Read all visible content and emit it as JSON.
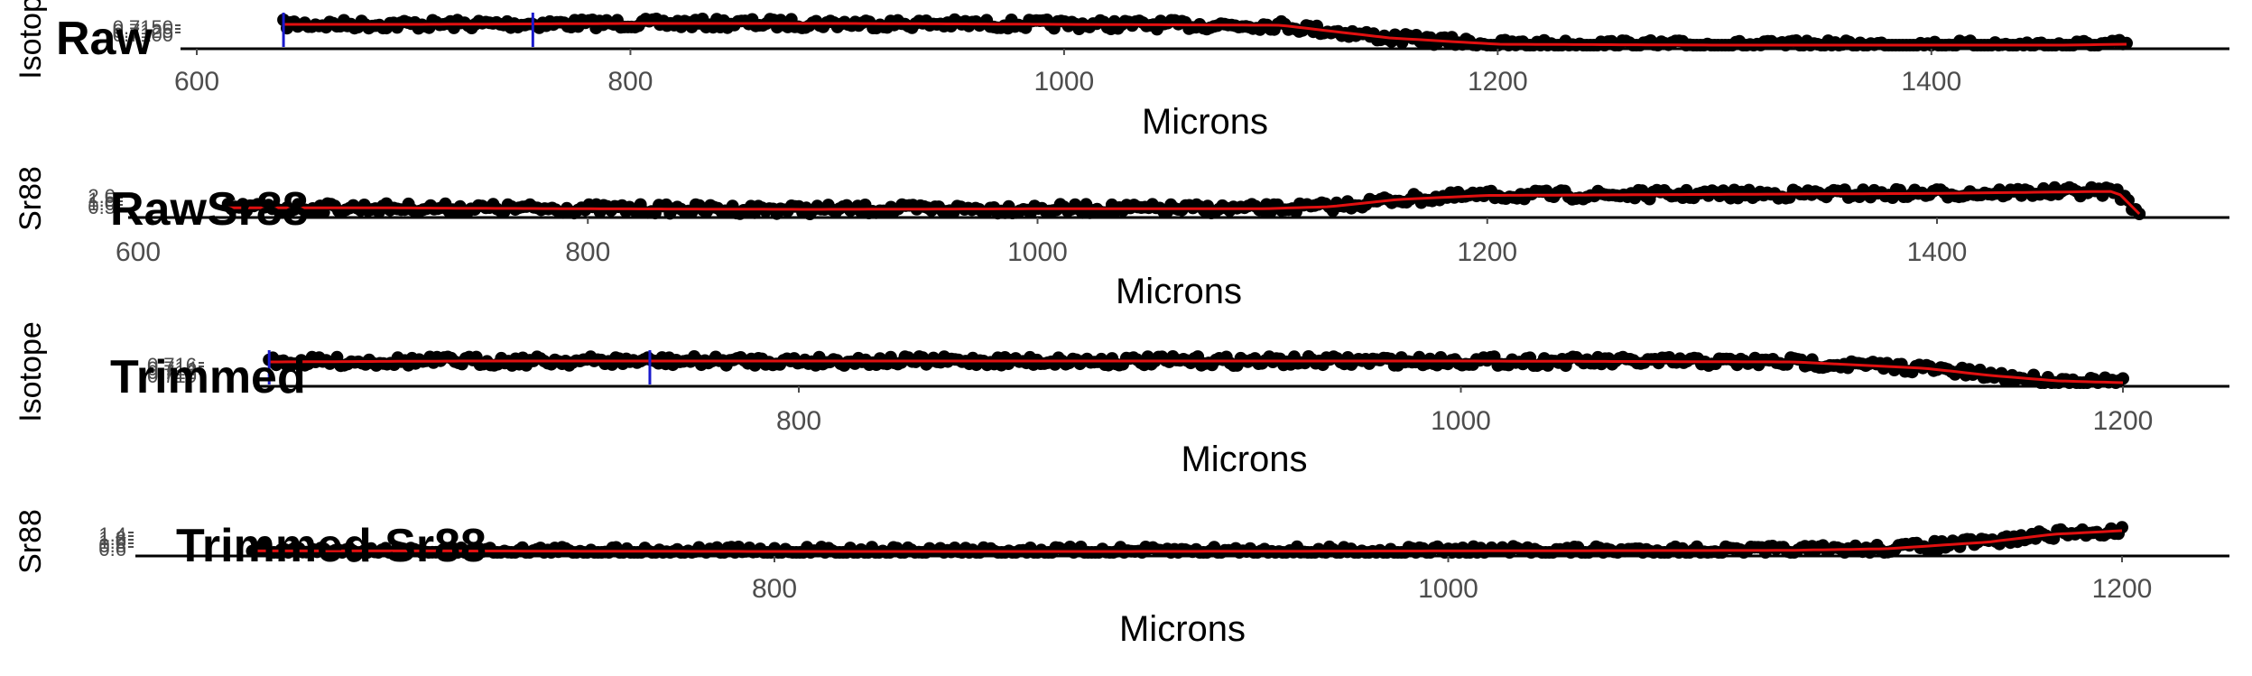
{
  "colors": {
    "points": "#000000",
    "smooth_line": "#e01010",
    "markers": "#1a1acc",
    "axis": "#000000",
    "tick_text": "#4d4d4d",
    "label_text": "#000000"
  },
  "chart_data": [
    {
      "type": "scatter",
      "title": "Raw",
      "xlabel": "Microns",
      "ylabel": "Isotope",
      "xlim": [
        600,
        1500
      ],
      "x_ticks": [
        600,
        800,
        1000,
        1200,
        1400
      ],
      "y_ticks": [
        "0.7150",
        "0.7125",
        "0.7100"
      ],
      "vlines": [
        640,
        755
      ],
      "series": [
        {
          "x": [
            640,
            700,
            800,
            900,
            1000,
            1100,
            1150,
            1200,
            1300,
            1400,
            1460,
            1490
          ],
          "values": [
            0.7125,
            0.7125,
            0.7126,
            0.7126,
            0.7125,
            0.7124,
            0.711,
            0.7103,
            0.7102,
            0.7102,
            0.7102,
            0.7103
          ]
        }
      ]
    },
    {
      "type": "scatter",
      "title": "RawSr88",
      "xlabel": "Microns",
      "ylabel": "Sr88",
      "xlim": [
        600,
        1500
      ],
      "x_ticks": [
        600,
        800,
        1000,
        1200,
        1400
      ],
      "y_ticks": [
        "2.0",
        "1.5",
        "1.0",
        "0.5"
      ],
      "vlines": [],
      "series": [
        {
          "x": [
            640,
            700,
            800,
            900,
            1000,
            1100,
            1130,
            1160,
            1200,
            1300,
            1400,
            1480,
            1490
          ],
          "values": [
            0.9,
            0.9,
            0.85,
            0.82,
            0.85,
            0.85,
            0.95,
            1.3,
            1.5,
            1.55,
            1.6,
            1.7,
            0.6
          ]
        }
      ]
    },
    {
      "type": "scatter",
      "title": "Trimmed",
      "xlabel": "Microns",
      "ylabel": "Isotope",
      "xlim": [
        630,
        1220
      ],
      "x_ticks": [
        800,
        1000,
        1200
      ],
      "y_ticks": [
        "0.716",
        "0.714",
        "0.712",
        "0.710"
      ],
      "vlines": [
        640,
        755
      ],
      "series": [
        {
          "x": [
            640,
            700,
            800,
            900,
            1000,
            1100,
            1140,
            1160,
            1180,
            1200
          ],
          "values": [
            0.7125,
            0.7126,
            0.7126,
            0.7126,
            0.7126,
            0.7125,
            0.7118,
            0.711,
            0.7104,
            0.7102
          ]
        }
      ]
    },
    {
      "type": "scatter",
      "title": "Trimmed Sr88",
      "xlabel": "Microns",
      "ylabel": "Sr88",
      "xlim": [
        630,
        1220
      ],
      "x_ticks": [
        800,
        1000,
        1200
      ],
      "y_ticks": [
        "1.4",
        "1.2",
        "1.0",
        "0.8",
        "0.6"
      ],
      "vlines": [],
      "series": [
        {
          "x": [
            645,
            700,
            800,
            900,
            1000,
            1100,
            1130,
            1160,
            1180,
            1200
          ],
          "values": [
            0.62,
            0.62,
            0.6,
            0.6,
            0.62,
            0.64,
            0.7,
            0.95,
            1.25,
            1.38
          ]
        }
      ]
    }
  ]
}
